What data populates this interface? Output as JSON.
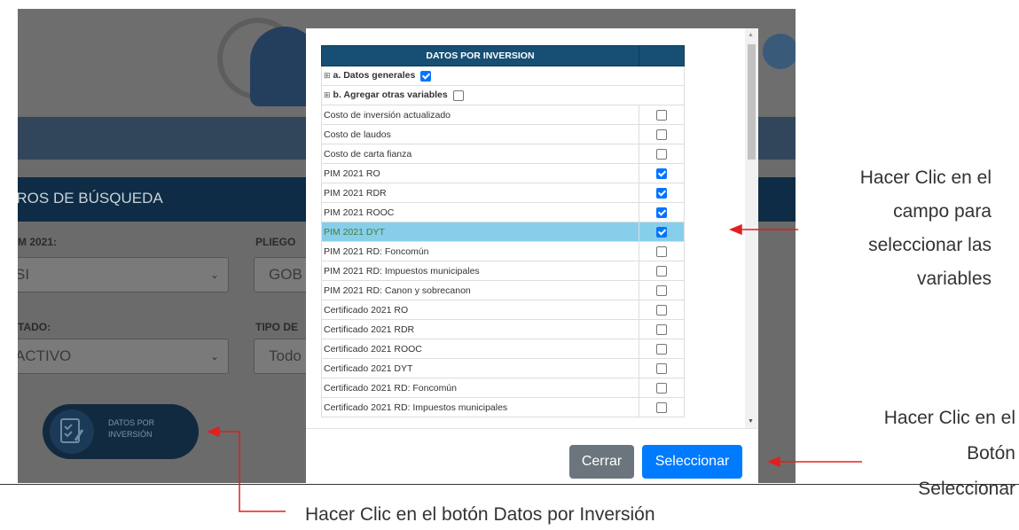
{
  "background": {
    "filters_header": "TROS DE BÚSQUEDA",
    "label_pim": "M 2021:",
    "label_pliego": "PLIEGO",
    "label_estado": "TADO:",
    "label_tipo": "TIPO DE",
    "select_pim": "SI",
    "select_pliego": "GOB",
    "select_estado": "ACTIVO",
    "select_tipo": "Todo",
    "datos_button_line1": "DATOS POR",
    "datos_button_line2": "INVERSIÓN"
  },
  "modal": {
    "table_header": "DATOS POR INVERSION",
    "groups": [
      {
        "label": "a. Datos generales",
        "checked": true
      },
      {
        "label": "b. Agregar otras variables",
        "checked": false
      }
    ],
    "rows": [
      {
        "label": "Costo de inversión actualizado",
        "checked": false
      },
      {
        "label": "Costo de laudos",
        "checked": false
      },
      {
        "label": "Costo de carta fianza",
        "checked": false
      },
      {
        "label": "PIM 2021 RO",
        "checked": true
      },
      {
        "label": "PIM 2021 RDR",
        "checked": true
      },
      {
        "label": "PIM 2021 ROOC",
        "checked": true
      },
      {
        "label": "PIM 2021 DYT",
        "checked": true,
        "highlighted": true
      },
      {
        "label": "PIM 2021 RD: Foncomún",
        "checked": false
      },
      {
        "label": "PIM 2021 RD: Impuestos municipales",
        "checked": false
      },
      {
        "label": "PIM 2021 RD: Canon y sobrecanon",
        "checked": false
      },
      {
        "label": "Certificado 2021 RO",
        "checked": false
      },
      {
        "label": "Certificado 2021 RDR",
        "checked": false
      },
      {
        "label": "Certificado 2021 ROOC",
        "checked": false
      },
      {
        "label": "Certificado 2021 DYT",
        "checked": false
      },
      {
        "label": "Certificado 2021 RD: Foncomún",
        "checked": false
      },
      {
        "label": "Certificado 2021 RD: Impuestos municipales",
        "checked": false
      }
    ],
    "close_label": "Cerrar",
    "select_label": "Seleccionar"
  },
  "annotations": {
    "variables_note": [
      "Hacer Clic en el",
      "campo para",
      "seleccionar las",
      "variables"
    ],
    "select_note": [
      "Hacer Clic en el",
      "Botón",
      "Seleccionar"
    ],
    "datos_note": "Hacer Clic en el botón Datos por Inversión"
  },
  "colors": {
    "table_header": "#174f74",
    "highlight_row": "#87ceeb",
    "select_button": "#007bff",
    "close_button": "#6c757d",
    "arrow": "#e02020"
  }
}
